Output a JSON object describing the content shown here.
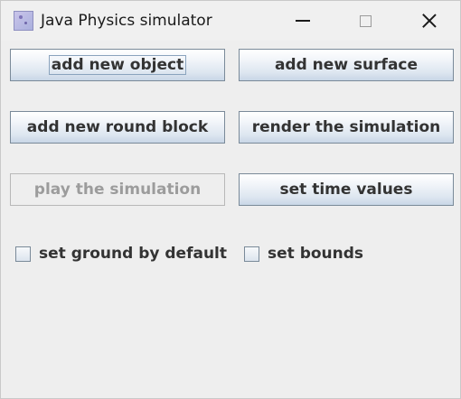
{
  "window": {
    "title": "Java Physics simulator",
    "icon": "java-app-icon",
    "controls": {
      "minimize": "minimize-icon",
      "maximize": "maximize-icon",
      "close": "close-icon"
    }
  },
  "buttons": {
    "add_new_object": "add new object",
    "add_new_surface": "add new surface",
    "add_new_round_block": "add new round block",
    "render_the_simulation": "render the simulation",
    "play_the_simulation": "play the simulation",
    "set_time_values": "set time values"
  },
  "checkboxes": {
    "set_ground_by_default": {
      "label": "set ground by default",
      "checked": false
    },
    "set_bounds": {
      "label": "set bounds",
      "checked": false
    }
  },
  "states": {
    "play_the_simulation_enabled": false,
    "focused_button": "add new object"
  }
}
